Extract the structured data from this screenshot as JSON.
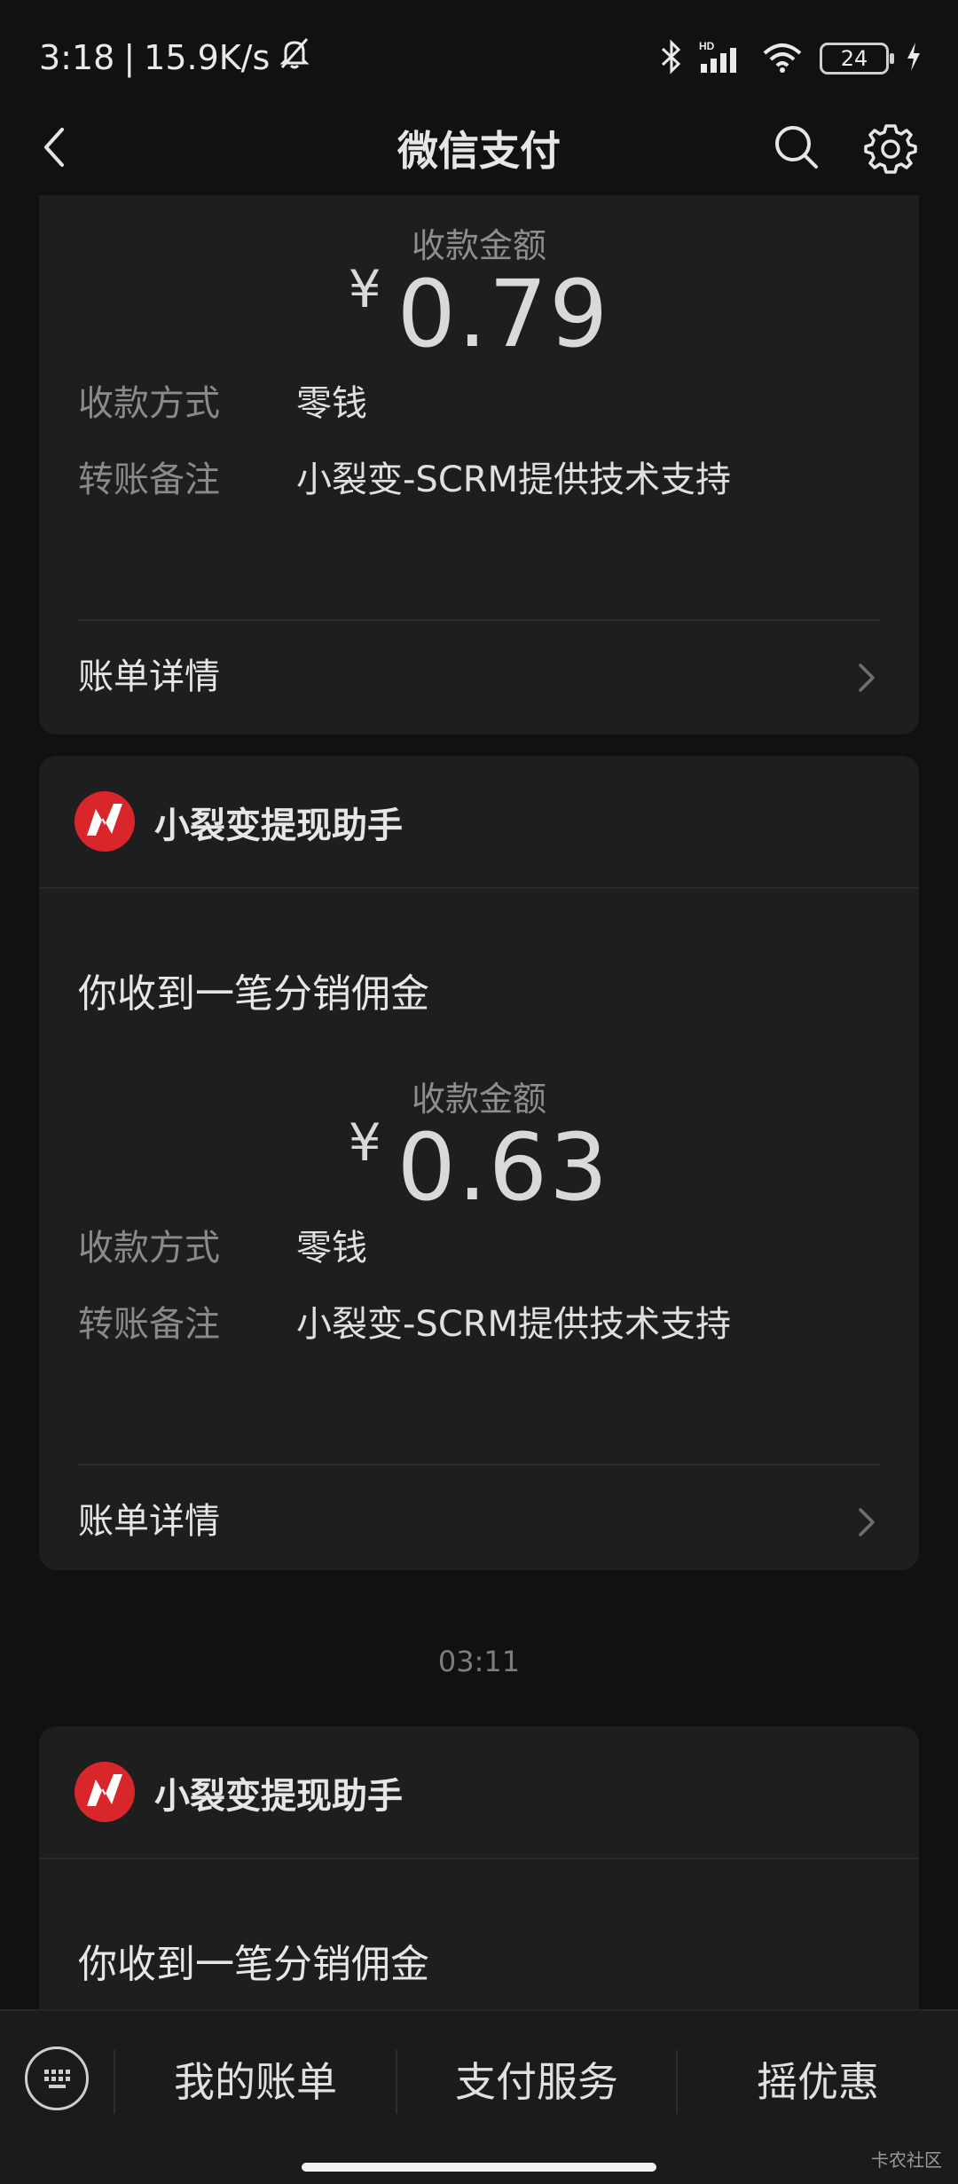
{
  "status_bar": {
    "time": "3:18",
    "separator": "|",
    "net_speed": "15.9K/s",
    "battery": "24"
  },
  "nav": {
    "title": "微信支付"
  },
  "cards": [
    {
      "amount_label": "收款金额",
      "currency": "¥",
      "amount": "0.79",
      "method_label": "收款方式",
      "method_value": "零钱",
      "note_label": "转账备注",
      "note_value": "小裂变-SCRM提供技术支持",
      "detail_label": "账单详情"
    },
    {
      "merchant": "小裂变提现助手",
      "message": "你收到一笔分销佣金",
      "amount_label": "收款金额",
      "currency": "¥",
      "amount": "0.63",
      "method_label": "收款方式",
      "method_value": "零钱",
      "note_label": "转账备注",
      "note_value": "小裂变-SCRM提供技术支持",
      "detail_label": "账单详情"
    },
    {
      "merchant": "小裂变提现助手",
      "message": "你收到一笔分销佣金"
    }
  ],
  "timestamp": "03:11",
  "bottom_menu": {
    "items": [
      "我的账单",
      "支付服务",
      "摇优惠"
    ]
  },
  "watermark": "卡农社区",
  "colors": {
    "background": "#111111",
    "card": "#1e1e1e",
    "logo_red": "#d9262b",
    "muted_text": "#8a8a8a"
  }
}
